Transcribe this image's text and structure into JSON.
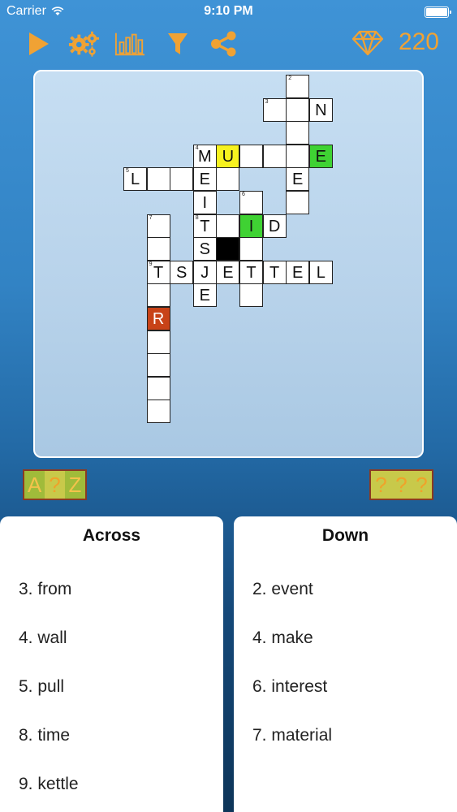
{
  "status": {
    "carrier": "Carrier",
    "time": "9:10 PM"
  },
  "toolbar": {
    "gems": "220",
    "accent": "#f0a234"
  },
  "board": {
    "cells": [
      {
        "r": 0,
        "c": 7,
        "n": "2",
        "t": ""
      },
      {
        "r": 1,
        "c": 6,
        "n": "3",
        "t": ""
      },
      {
        "r": 1,
        "c": 7,
        "n": "",
        "t": ""
      },
      {
        "r": 1,
        "c": 8,
        "n": "",
        "t": "N"
      },
      {
        "r": 2,
        "c": 7,
        "n": "",
        "t": ""
      },
      {
        "r": 3,
        "c": 3,
        "n": "4",
        "t": "M"
      },
      {
        "r": 3,
        "c": 4,
        "n": "",
        "t": "U",
        "s": "yellow"
      },
      {
        "r": 3,
        "c": 5,
        "n": "",
        "t": ""
      },
      {
        "r": 3,
        "c": 6,
        "n": "",
        "t": ""
      },
      {
        "r": 3,
        "c": 7,
        "n": "",
        "t": ""
      },
      {
        "r": 3,
        "c": 8,
        "n": "",
        "t": "E",
        "s": "green"
      },
      {
        "r": 4,
        "c": 0,
        "n": "5",
        "t": "L"
      },
      {
        "r": 4,
        "c": 1,
        "n": "",
        "t": ""
      },
      {
        "r": 4,
        "c": 2,
        "n": "",
        "t": ""
      },
      {
        "r": 4,
        "c": 3,
        "n": "",
        "t": "E"
      },
      {
        "r": 4,
        "c": 4,
        "n": "",
        "t": ""
      },
      {
        "r": 4,
        "c": 7,
        "n": "",
        "t": "E"
      },
      {
        "r": 5,
        "c": 3,
        "n": "",
        "t": "I"
      },
      {
        "r": 5,
        "c": 5,
        "n": "6",
        "t": ""
      },
      {
        "r": 5,
        "c": 7,
        "n": "",
        "t": ""
      },
      {
        "r": 6,
        "c": 1,
        "n": "7",
        "t": ""
      },
      {
        "r": 6,
        "c": 3,
        "n": "8",
        "t": "T"
      },
      {
        "r": 6,
        "c": 4,
        "n": "",
        "t": ""
      },
      {
        "r": 6,
        "c": 5,
        "n": "",
        "t": "I",
        "s": "green"
      },
      {
        "r": 6,
        "c": 6,
        "n": "",
        "t": "D"
      },
      {
        "r": 7,
        "c": 1,
        "n": "",
        "t": ""
      },
      {
        "r": 7,
        "c": 3,
        "n": "",
        "t": "S"
      },
      {
        "r": 7,
        "c": 4,
        "n": "",
        "t": "",
        "s": "black"
      },
      {
        "r": 7,
        "c": 5,
        "n": "",
        "t": ""
      },
      {
        "r": 8,
        "c": 1,
        "n": "9",
        "t": "T"
      },
      {
        "r": 8,
        "c": 2,
        "n": "",
        "t": "S"
      },
      {
        "r": 8,
        "c": 3,
        "n": "",
        "t": "J"
      },
      {
        "r": 8,
        "c": 4,
        "n": "",
        "t": "E"
      },
      {
        "r": 8,
        "c": 5,
        "n": "",
        "t": "T"
      },
      {
        "r": 8,
        "c": 6,
        "n": "",
        "t": "T"
      },
      {
        "r": 8,
        "c": 7,
        "n": "",
        "t": "E"
      },
      {
        "r": 8,
        "c": 8,
        "n": "",
        "t": "L"
      },
      {
        "r": 9,
        "c": 1,
        "n": "",
        "t": ""
      },
      {
        "r": 9,
        "c": 3,
        "n": "",
        "t": "E"
      },
      {
        "r": 9,
        "c": 5,
        "n": "",
        "t": ""
      },
      {
        "r": 10,
        "c": 1,
        "n": "",
        "t": "R",
        "s": "red"
      },
      {
        "r": 11,
        "c": 1,
        "n": "",
        "t": ""
      },
      {
        "r": 12,
        "c": 1,
        "n": "",
        "t": ""
      },
      {
        "r": 13,
        "c": 1,
        "n": "",
        "t": ""
      },
      {
        "r": 14,
        "c": 1,
        "n": "",
        "t": ""
      }
    ]
  },
  "helpers": {
    "left": [
      "A",
      "?",
      "Z"
    ],
    "right": [
      "?",
      "?",
      "?"
    ]
  },
  "across": {
    "title": "Across",
    "clues": [
      "3. from",
      "4. wall",
      "5. pull",
      "8. time",
      "9. kettle"
    ]
  },
  "down": {
    "title": "Down",
    "clues": [
      "2. event",
      "4. make",
      "6. interest",
      "7. material"
    ]
  }
}
